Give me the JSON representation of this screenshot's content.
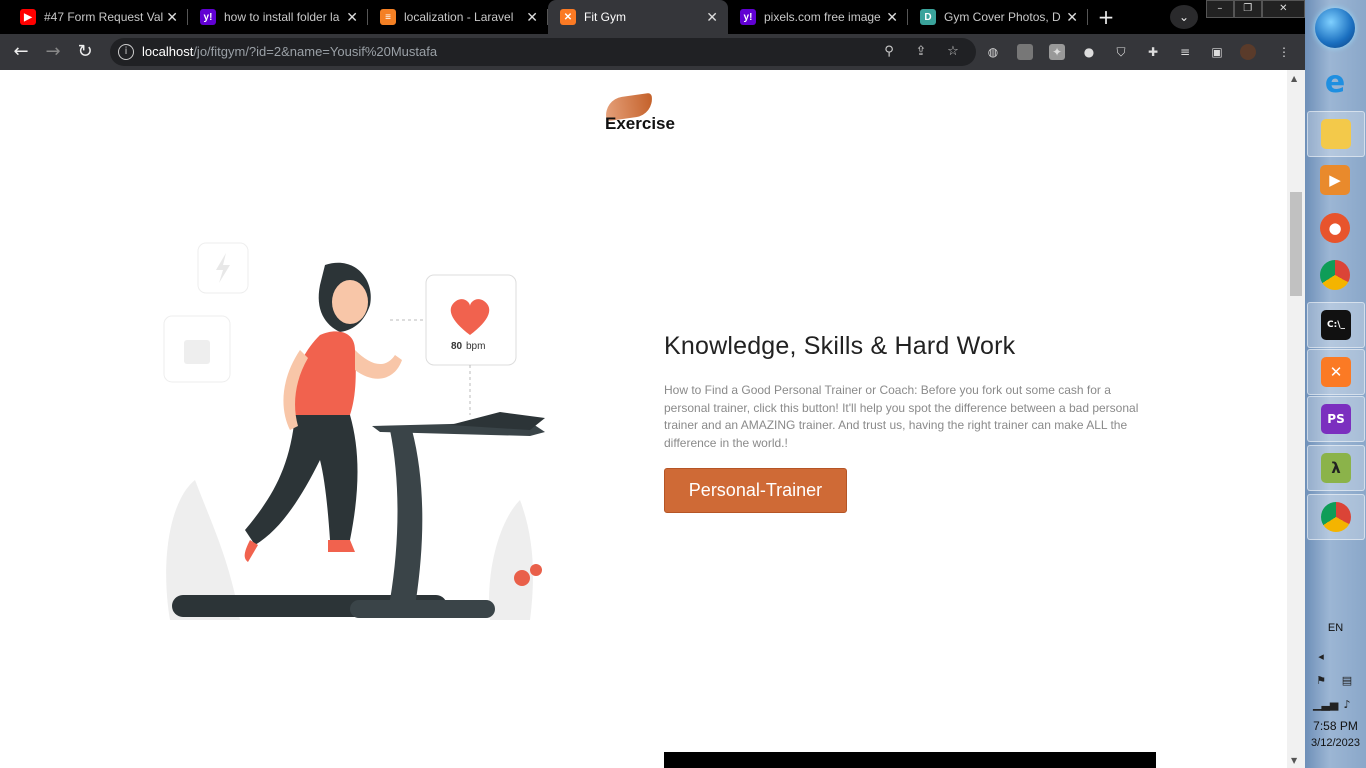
{
  "browser": {
    "tabs": [
      {
        "title": "#47 Form Request Val",
        "favicon": "youtube-icon",
        "color": "#ff0000",
        "glyph": "▶"
      },
      {
        "title": "how to install folder la",
        "favicon": "yahoo-icon",
        "color": "#6001d2",
        "glyph": "y!"
      },
      {
        "title": "localization - Laravel",
        "favicon": "stackoverflow-icon",
        "color": "#f48024",
        "glyph": "≡"
      },
      {
        "title": "Fit Gym",
        "favicon": "xampp-icon",
        "color": "#fb7a24",
        "glyph": "✕",
        "active": true
      },
      {
        "title": "pixels.com free image",
        "favicon": "yahoo-icon",
        "color": "#6001d2",
        "glyph": "y!"
      },
      {
        "title": "Gym Cover Photos, D",
        "favicon": "site-d-icon",
        "color": "#3aa39b",
        "glyph": "D"
      }
    ],
    "url_host": "localhost",
    "url_path": "/jo/fitgym/?id=2&name=Yousif%20Mustafa"
  },
  "page": {
    "logo_text": "Exercise",
    "illustration": {
      "bpm_value": "80",
      "bpm_unit": "bpm"
    },
    "heading": "Knowledge, Skills & Hard Work",
    "paragraph": "How to Find a Good Personal Trainer or Coach: Before you fork out some cash for a personal trainer, click this button! It'll help you spot the difference between a bad personal trainer and an AMAZING trainer. And trust us, having the right trainer can make ALL the difference in the world.!",
    "button_label": "Personal-Trainer",
    "accent_color": "#cf6a36"
  },
  "taskbar": {
    "apps": [
      "internet-explorer",
      "file-explorer",
      "media-player",
      "firefox",
      "chrome",
      "command-prompt",
      "xampp",
      "phpstorm",
      "lambda-app",
      "chrome-profile"
    ],
    "language": "EN",
    "time": "7:58 PM",
    "date": "3/12/2023"
  }
}
